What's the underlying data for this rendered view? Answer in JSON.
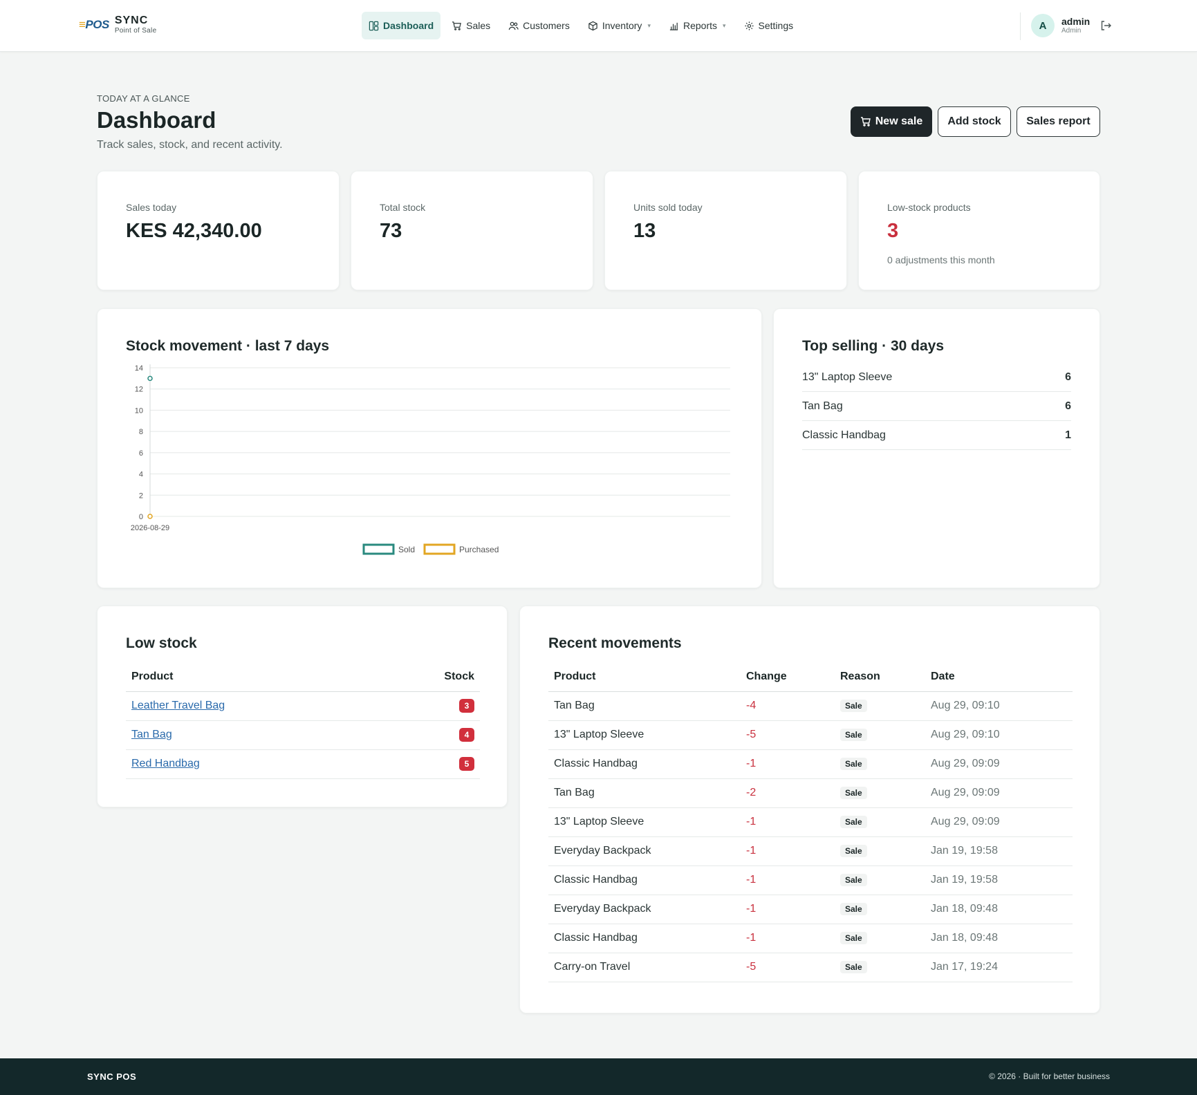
{
  "brand": {
    "logo": "POS",
    "name": "SYNC",
    "sub": "Point of Sale"
  },
  "nav": {
    "items": [
      {
        "label": "Dashboard",
        "active": true
      },
      {
        "label": "Sales"
      },
      {
        "label": "Customers"
      },
      {
        "label": "Inventory",
        "dropdown": true
      },
      {
        "label": "Reports",
        "dropdown": true
      },
      {
        "label": "Settings"
      }
    ]
  },
  "user": {
    "initial": "A",
    "name": "admin",
    "role": "Admin"
  },
  "header": {
    "eyebrow": "TODAY AT A GLANCE",
    "title": "Dashboard",
    "subtitle": "Track sales, stock, and recent activity."
  },
  "actions": {
    "new_sale": "New sale",
    "add_stock": "Add stock",
    "sales_report": "Sales report"
  },
  "stats": [
    {
      "label": "Sales today",
      "value": "KES 42,340.00"
    },
    {
      "label": "Total stock",
      "value": "73"
    },
    {
      "label": "Units sold today",
      "value": "13"
    },
    {
      "label": "Low-stock products",
      "value": "3",
      "note": "0 adjustments this month",
      "color": "#c9303e"
    }
  ],
  "stock_movement": {
    "title": "Stock movement · last 7 days",
    "chart_data": {
      "type": "line",
      "x": [
        "2026-08-29"
      ],
      "series": [
        {
          "name": "Sold",
          "values": [
            13
          ],
          "color": "#2a8a7f"
        },
        {
          "name": "Purchased",
          "values": [
            0
          ],
          "color": "#e2a623"
        }
      ],
      "yticks": [
        "0",
        "2",
        "4",
        "6",
        "8",
        "10",
        "12",
        "14"
      ],
      "ylim": [
        0,
        14
      ],
      "legend": "bottom",
      "grid": true
    }
  },
  "top_selling": {
    "title": "Top selling · 30 days",
    "items": [
      {
        "name": "13\" Laptop Sleeve",
        "count": "6"
      },
      {
        "name": "Tan Bag",
        "count": "6"
      },
      {
        "name": "Classic Handbag",
        "count": "1"
      }
    ]
  },
  "low_stock": {
    "title": "Low stock",
    "columns": {
      "product": "Product",
      "stock": "Stock"
    },
    "rows": [
      {
        "product": "Leather Travel Bag",
        "stock": "3"
      },
      {
        "product": "Tan Bag",
        "stock": "4"
      },
      {
        "product": "Red Handbag",
        "stock": "5"
      }
    ]
  },
  "recent": {
    "title": "Recent movements",
    "columns": {
      "product": "Product",
      "change": "Change",
      "reason": "Reason",
      "date": "Date"
    },
    "rows": [
      {
        "product": "Tan Bag",
        "change": "-4",
        "reason": "Sale",
        "date": "Aug 29, 09:10"
      },
      {
        "product": "13\" Laptop Sleeve",
        "change": "-5",
        "reason": "Sale",
        "date": "Aug 29, 09:10"
      },
      {
        "product": "Classic Handbag",
        "change": "-1",
        "reason": "Sale",
        "date": "Aug 29, 09:09"
      },
      {
        "product": "Tan Bag",
        "change": "-2",
        "reason": "Sale",
        "date": "Aug 29, 09:09"
      },
      {
        "product": "13\" Laptop Sleeve",
        "change": "-1",
        "reason": "Sale",
        "date": "Aug 29, 09:09"
      },
      {
        "product": "Everyday Backpack",
        "change": "-1",
        "reason": "Sale",
        "date": "Jan 19, 19:58"
      },
      {
        "product": "Classic Handbag",
        "change": "-1",
        "reason": "Sale",
        "date": "Jan 19, 19:58"
      },
      {
        "product": "Everyday Backpack",
        "change": "-1",
        "reason": "Sale",
        "date": "Jan 18, 09:48"
      },
      {
        "product": "Classic Handbag",
        "change": "-1",
        "reason": "Sale",
        "date": "Jan 18, 09:48"
      },
      {
        "product": "Carry-on Travel",
        "change": "-5",
        "reason": "Sale",
        "date": "Jan 17, 19:24"
      }
    ]
  },
  "footer": {
    "brand": "SYNC POS",
    "copy": "© 2026 · Built for better business"
  }
}
